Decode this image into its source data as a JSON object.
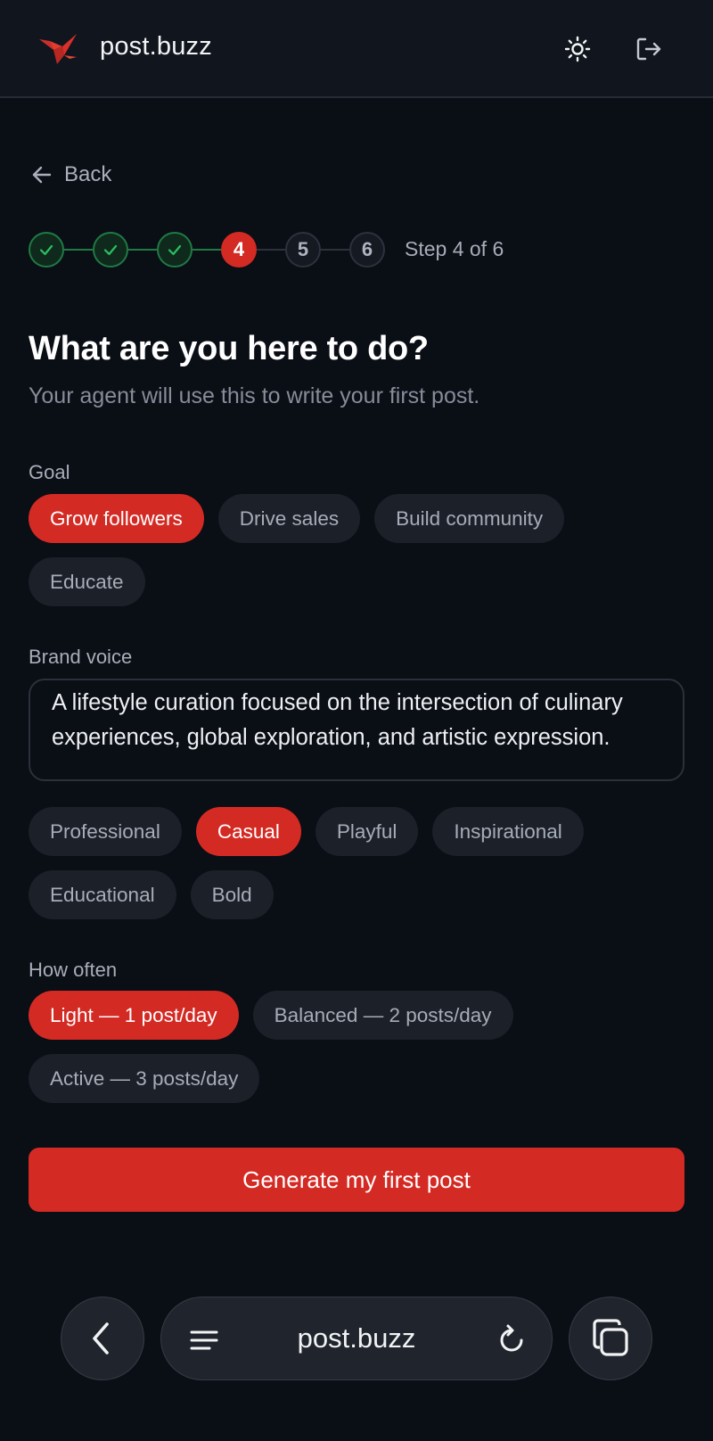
{
  "header": {
    "brand": "post.buzz",
    "logo_icon": "bird-logo-icon",
    "theme_icon": "sun-icon",
    "logout_icon": "logout-icon"
  },
  "back": {
    "label": "Back"
  },
  "stepper": {
    "steps": [
      {
        "label": "",
        "state": "done"
      },
      {
        "label": "",
        "state": "done"
      },
      {
        "label": "",
        "state": "done"
      },
      {
        "label": "4",
        "state": "current"
      },
      {
        "label": "5",
        "state": "todo"
      },
      {
        "label": "6",
        "state": "todo"
      }
    ],
    "status": "Step 4 of 6"
  },
  "main": {
    "title": "What are you here to do?",
    "subtitle": "Your agent will use this to write your first post."
  },
  "goal": {
    "label": "Goal",
    "options": [
      "Grow followers",
      "Drive sales",
      "Build community",
      "Educate"
    ],
    "selected": "Grow followers"
  },
  "voice": {
    "label": "Brand voice",
    "value": "A lifestyle curation focused on the intersection of culinary experiences, global exploration, and artistic expression.",
    "options": [
      "Professional",
      "Casual",
      "Playful",
      "Inspirational",
      "Educational",
      "Bold"
    ],
    "selected": "Casual"
  },
  "frequency": {
    "label": "How often",
    "options": [
      "Light — 1 post/day",
      "Balanced — 2 posts/day",
      "Active — 3 posts/day"
    ],
    "selected": "Light — 1 post/day"
  },
  "cta": {
    "label": "Generate my first post"
  },
  "browser": {
    "url": "post.buzz",
    "back_icon": "chevron-left-icon",
    "menu_icon": "menu-icon",
    "reload_icon": "reload-icon",
    "tabs_icon": "tabs-icon"
  },
  "colors": {
    "accent": "#d42a24",
    "success": "#22c55e",
    "background": "#0a0e15",
    "chip": "#1b2029"
  }
}
